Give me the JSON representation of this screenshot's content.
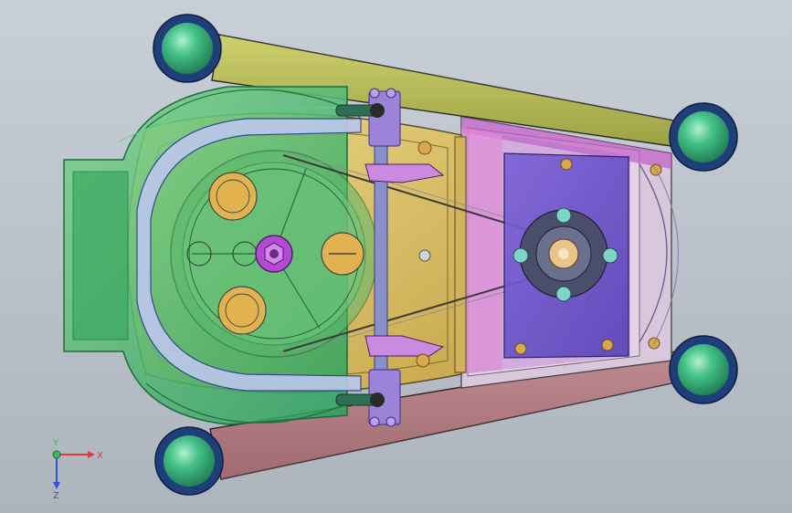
{
  "view": {
    "background_top": "#c9cfd7",
    "background_bottom": "#aeb4bc"
  },
  "parts": {
    "wheel_color": "#3bb07a",
    "wheel_rim_color": "#1f3f7a",
    "frame_color": "#e2c86c",
    "cover_color": "#3fbf6a",
    "motor_plate_color": "#6f55c8",
    "side_bar_top_color": "#b7b955",
    "side_bar_bottom_color": "#b0767c",
    "magenta_panel_color": "#d987d6",
    "hub_color": "#b24ad6"
  },
  "triad": {
    "x_label": "X",
    "y_label": "Y",
    "z_label": "Z",
    "x_color": "#e23b3b",
    "y_color": "#2fbf5a",
    "z_color": "#2f57d6"
  }
}
